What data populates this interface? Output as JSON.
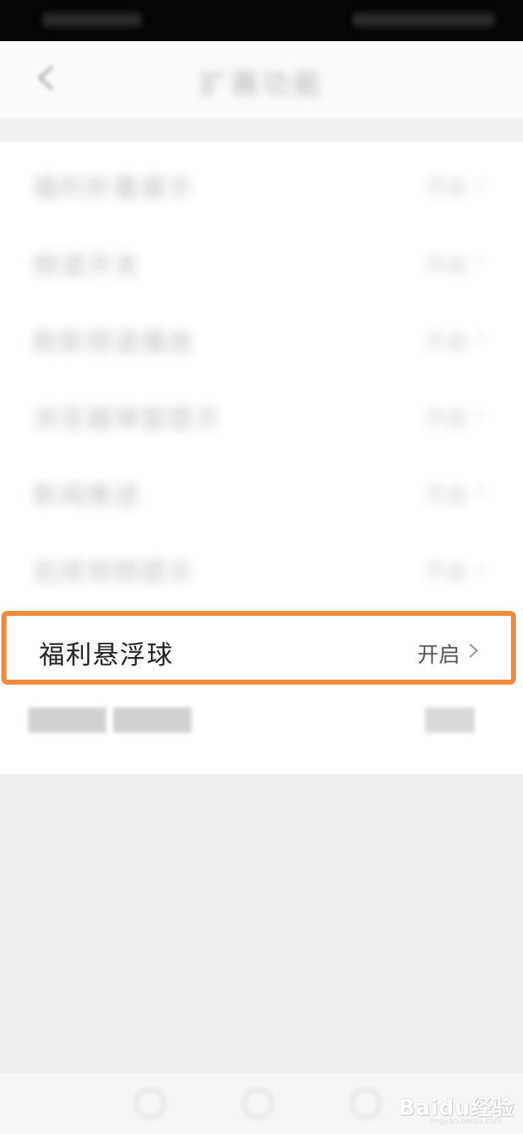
{
  "nav": {
    "title": "扩展功能"
  },
  "list": {
    "items": [
      {
        "label": "福利折叠展示",
        "value": "开启"
      },
      {
        "label": "频道开关",
        "value": "开启"
      },
      {
        "label": "刷新频道播放",
        "value": "开启"
      },
      {
        "label": "浏览器弹窗提示",
        "value": "开启"
      },
      {
        "label": "新闻推送",
        "value": "开启"
      },
      {
        "label": "后续视频提示",
        "value": "开启"
      }
    ],
    "highlighted": {
      "label": "福利悬浮球",
      "value": "开启"
    }
  },
  "watermark": {
    "brand": "Baidu经验",
    "site": "jingyan.baidu.com"
  },
  "colors": {
    "highlight_border": "#ef8a3f",
    "background": "#efefef"
  }
}
